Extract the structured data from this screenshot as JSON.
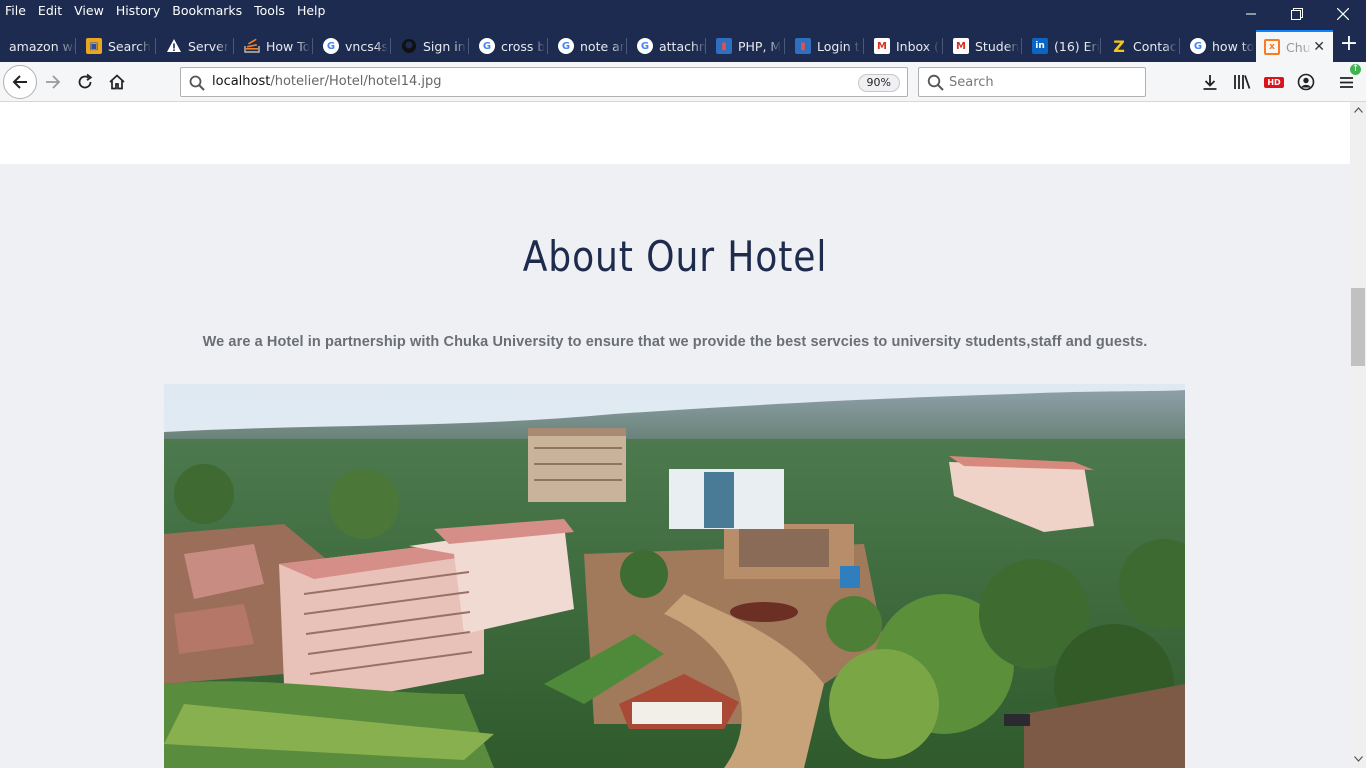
{
  "menu": [
    "File",
    "Edit",
    "View",
    "History",
    "Bookmarks",
    "Tools",
    "Help"
  ],
  "tabs": [
    {
      "label": "amazon we",
      "icon": "none"
    },
    {
      "label": "Search",
      "icon": "box-icon"
    },
    {
      "label": "Server",
      "icon": "warning-icon"
    },
    {
      "label": "How To",
      "icon": "stackoverflow-icon"
    },
    {
      "label": "vncs4s",
      "icon": "google-icon"
    },
    {
      "label": "Sign in",
      "icon": "github-icon"
    },
    {
      "label": "cross b",
      "icon": "google-icon"
    },
    {
      "label": "note ar",
      "icon": "google-icon"
    },
    {
      "label": "attachm",
      "icon": "google-icon"
    },
    {
      "label": "PHP, M",
      "icon": "bookmark-icon"
    },
    {
      "label": "Login t",
      "icon": "bookmark-icon"
    },
    {
      "label": "Inbox (",
      "icon": "gmail-icon"
    },
    {
      "label": "Studen",
      "icon": "gmail-icon"
    },
    {
      "label": "(16) Eri",
      "icon": "linkedin-icon"
    },
    {
      "label": "Contac",
      "icon": "zoho-icon"
    },
    {
      "label": "how to",
      "icon": "google-icon"
    },
    {
      "label": "Chu",
      "icon": "xampp-icon"
    }
  ],
  "url": {
    "host": "localhost",
    "path": "/hotelier/Hotel/hotel14.jpg"
  },
  "zoom": "90%",
  "search": {
    "placeholder": "Search"
  },
  "page": {
    "heading": "About Our Hotel",
    "description": "We are a Hotel in partnership with Chuka University to ensure that we provide the best servcies to university students,staff and guests."
  },
  "colors": {
    "titlebar": "#1c2b4f",
    "heading": "#1e2b4d",
    "section_bg": "#eef0f4",
    "accent": "#0a84ff"
  }
}
